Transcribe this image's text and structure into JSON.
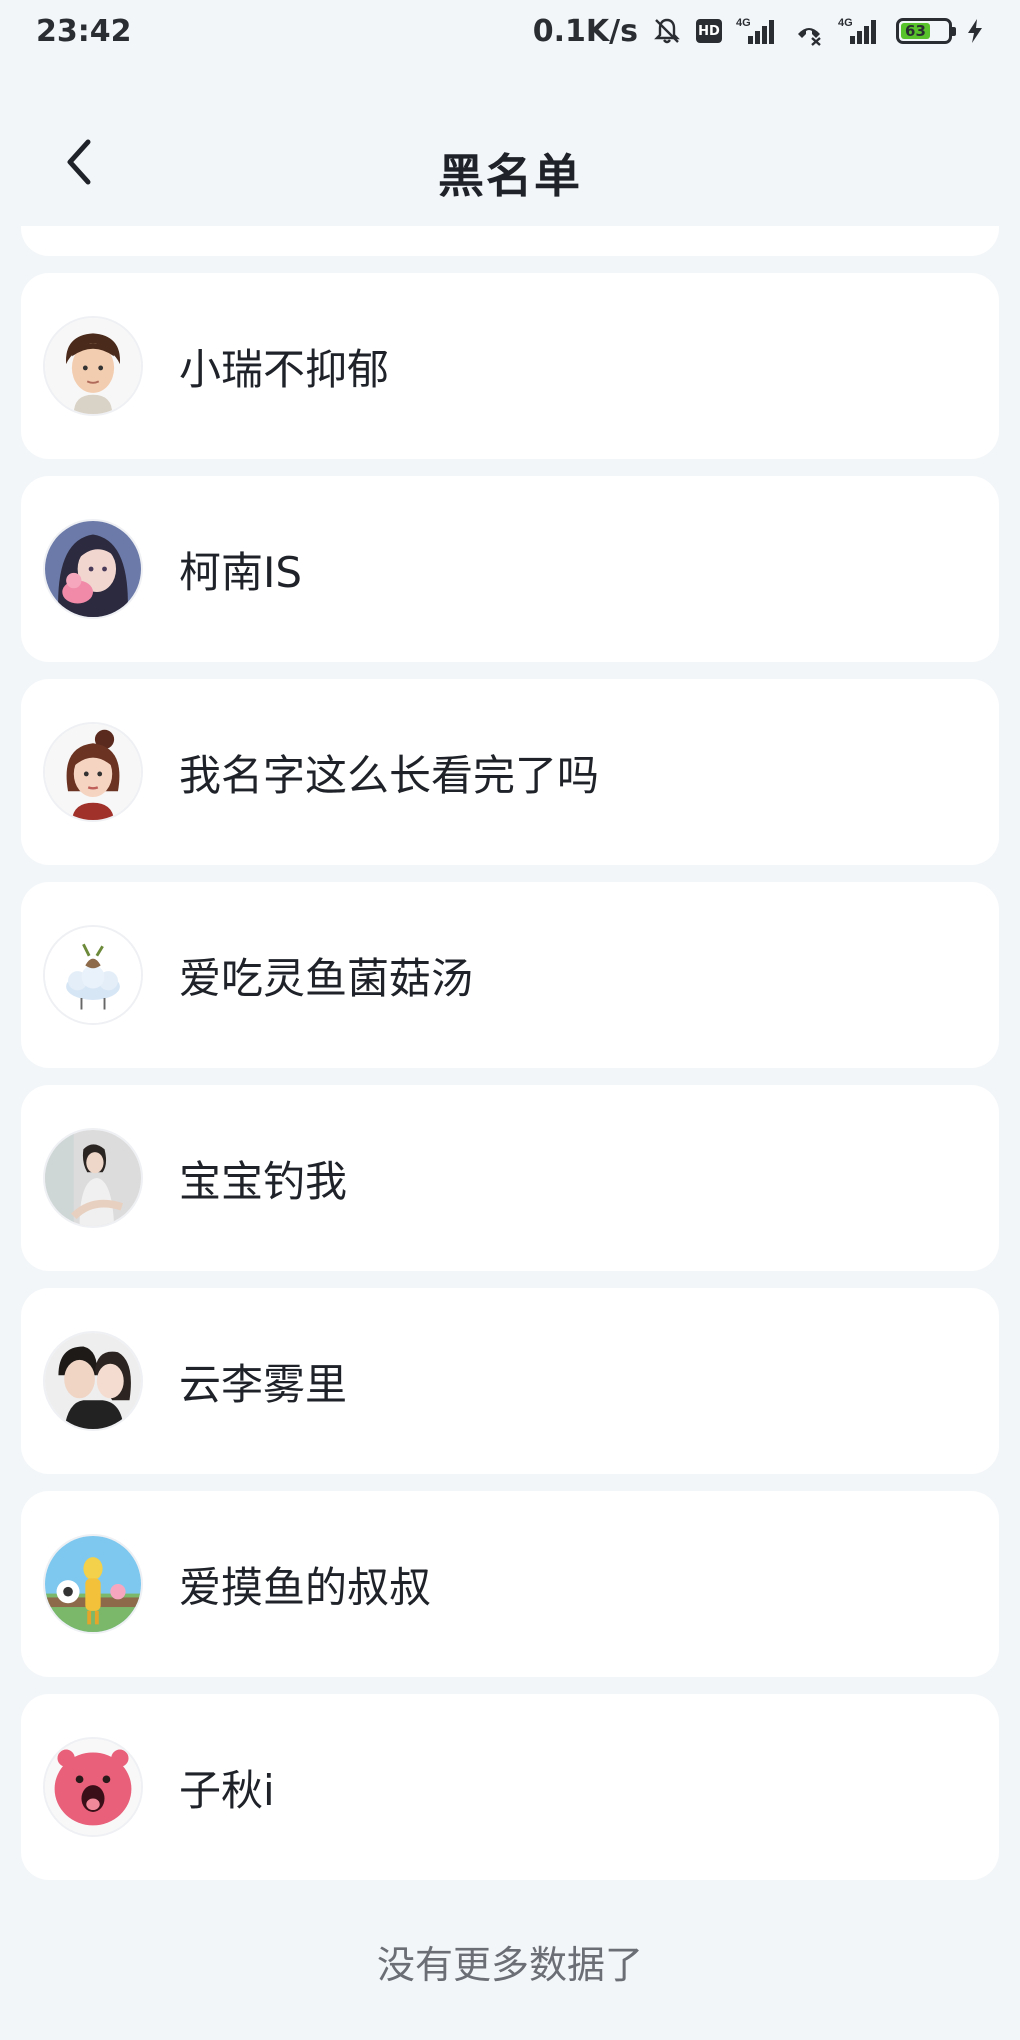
{
  "status_bar": {
    "time": "23:42",
    "network_speed": "0.1K/s",
    "hd_label": "HD",
    "signal_1_label": "4G",
    "signal_2_label": "4G",
    "battery_level": "63",
    "battery_fraction": 0.63,
    "battery_color": "#57c22b"
  },
  "nav": {
    "back_icon": "chevron-left-icon",
    "title": "黑名单"
  },
  "blacklist": [
    {
      "name": "小瑞不抑郁",
      "avatar": "boy-character-avatar"
    },
    {
      "name": "柯南IS",
      "avatar": "anime-girl-avatar"
    },
    {
      "name": "我名字这么长看完了吗",
      "avatar": "girl-character-avatar"
    },
    {
      "name": "爱吃灵鱼菌菇汤",
      "avatar": "cloud-creature-avatar"
    },
    {
      "name": "宝宝钓我",
      "avatar": "photo-girl-avatar"
    },
    {
      "name": "云李雾里",
      "avatar": "couple-photo-avatar"
    },
    {
      "name": "爱摸鱼的叔叔",
      "avatar": "cartoon-figure-avatar"
    },
    {
      "name": "子秋i",
      "avatar": "pink-creature-avatar"
    }
  ],
  "footer": {
    "no_more_text": "没有更多数据了"
  },
  "colors": {
    "background": "#f3f6f9",
    "card": "#ffffff",
    "text_primary": "#1f2329",
    "text_secondary": "#6b6f75"
  }
}
